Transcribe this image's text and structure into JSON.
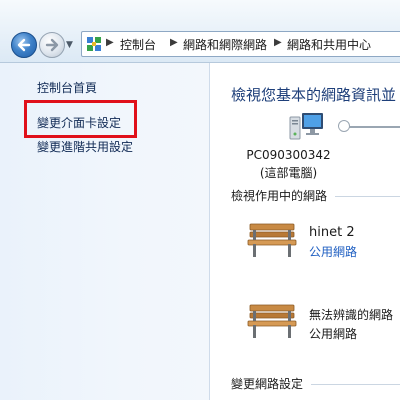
{
  "breadcrumb": {
    "items": [
      "控制台",
      "網路和網際網路",
      "網路和共用中心"
    ]
  },
  "sidebar": {
    "items": [
      {
        "label": "控制台首頁"
      },
      {
        "label": "變更介面卡設定"
      },
      {
        "label": "變更進階共用設定"
      }
    ],
    "highlight_color": "#e0101a"
  },
  "main": {
    "title": "檢視您基本的網路資訊並",
    "computer": {
      "name": "PC090300342",
      "subtitle": "(這部電腦)"
    },
    "active_networks_heading": "檢視作用中的網路",
    "networks": [
      {
        "name": "hinet  2",
        "type": "公用網路",
        "type_is_link": true
      },
      {
        "name": "無法辨識的網路",
        "type": "公用網路",
        "type_is_link": false
      }
    ],
    "change_settings_heading": "變更網路設定"
  },
  "colors": {
    "title_blue": "#1e3f7a",
    "link_blue": "#1f5fc2",
    "sidebar_bg": "#eaf2fb"
  },
  "icons": [
    "back-arrow-icon",
    "forward-arrow-icon",
    "history-chevron-icon",
    "control-panel-icon",
    "computer-icon",
    "bench-icon"
  ]
}
